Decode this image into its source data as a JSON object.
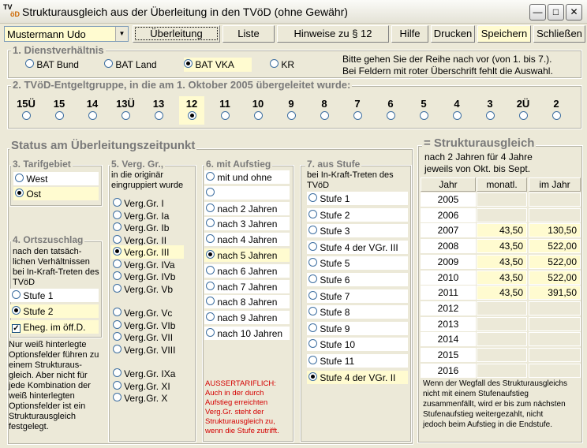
{
  "window": {
    "title": "Strukturausgleich aus der Überleitung in den TVöD (ohne Gewähr)",
    "icon_top": "TV",
    "icon_bottom": "öD"
  },
  "toolbar": {
    "user": "Mustermann Udo",
    "buttons": [
      "Überleitung",
      "Liste",
      "Hinweise zu § 12",
      "Hilfe",
      "Drucken",
      "Speichern",
      "Schließen"
    ]
  },
  "section1": {
    "legend": "1. Dienstverhältnis",
    "options": [
      "BAT Bund",
      "BAT Land",
      "BAT VKA",
      "KR"
    ],
    "selected": "BAT VKA",
    "hint1": "Bitte gehen Sie der Reihe nach vor (von 1. bis 7.).",
    "hint2": "Bei Feldern mit roter Überschrift fehlt die Auswahl."
  },
  "section2": {
    "legend": "2. TVöD-Entgeltgruppe, in die am 1. Oktober 2005 übergeleitet wurde:",
    "groups": [
      "15Ü",
      "15",
      "14",
      "13Ü",
      "13",
      "12",
      "11",
      "10",
      "9",
      "8",
      "7",
      "6",
      "5",
      "4",
      "3",
      "2Ü",
      "2"
    ],
    "selected": "12"
  },
  "status": {
    "title": "Status am Überleitungszeitpunkt"
  },
  "tarif": {
    "legend": "3. Tarifgebiet",
    "options": [
      "West",
      "Ost"
    ],
    "selected": "Ost"
  },
  "ortszuschlag": {
    "legend": "4. Ortszuschlag",
    "desc": [
      "nach den tatsäch-",
      "lichen Verhältnissen",
      "bei In-Kraft-Treten des",
      "TVöD"
    ],
    "options": [
      "Stufe 1",
      "Stufe 2"
    ],
    "selected": "Stufe 2",
    "checkbox": "Eheg. im öff.D.",
    "checked": true
  },
  "note_left": [
    "Nur weiß hinterlegte",
    "Optionsfelder führen zu",
    "einem Strukturaus-",
    "gleich. Aber nicht für",
    "jede Kombination der",
    "weiß hinterlegten",
    "Optionsfelder ist ein",
    "Strukturausgleich",
    "festgelegt."
  ],
  "verg": {
    "legend": "5. Verg. Gr.,",
    "desc": [
      "in die originär",
      "eingruppiert wurde"
    ],
    "groups1": [
      "Verg.Gr. I",
      "Verg.Gr. Ia",
      "Verg.Gr. Ib",
      "Verg.Gr. II",
      "Verg.Gr. III",
      "Verg.Gr. IVa",
      "Verg.Gr. IVb",
      "Verg.Gr. Vb"
    ],
    "groups2": [
      "Verg.Gr. Vc",
      "Verg.Gr. VIb",
      "Verg.Gr. VII",
      "Verg.Gr. VIII"
    ],
    "groups3": [
      "Verg.Gr. IXa",
      "Verg.Gr. XI",
      "Verg.Gr. X"
    ],
    "selected": "Verg.Gr. III"
  },
  "aufstieg": {
    "legend": "6. mit Aufstieg",
    "options": [
      "mit und ohne",
      "",
      "nach 2 Jahren",
      "nach 3 Jahren",
      "nach 4 Jahren",
      "nach 5 Jahren",
      "nach 6 Jahren",
      "nach 7 Jahren",
      "nach 8 Jahren",
      "nach 9 Jahren",
      "nach 10 Jahren"
    ],
    "selected": "nach 5 Jahren",
    "red_note": [
      "AUSSERTARIFLICH:",
      "Auch in der durch",
      "Aufstieg erreichten",
      "Verg.Gr. steht der",
      "Strukturausgleich zu,",
      "wenn die Stufe zutrifft."
    ]
  },
  "stufe": {
    "legend": "7. aus Stufe",
    "desc": [
      "bei In-Kraft-Treten des",
      "TVöD"
    ],
    "options": [
      "Stufe 1",
      "Stufe 2",
      "Stufe 3",
      "Stufe 4 der VGr. III",
      "Stufe 5",
      "Stufe 6",
      "Stufe 7",
      "Stufe 8",
      "Stufe 9",
      "Stufe 10",
      "Stufe 11",
      "Stufe 4 der VGr. II"
    ],
    "selected": "Stufe 4 der VGr. II"
  },
  "struktur": {
    "legend": "= Strukturausgleich",
    "desc": [
      "nach 2 Jahren für 4 Jahre",
      "jeweils von Okt. bis Sept."
    ],
    "headers": [
      "Jahr",
      "monatl.",
      "im Jahr"
    ],
    "rows": [
      {
        "year": "2005",
        "monthly": "",
        "yearly": ""
      },
      {
        "year": "2006",
        "monthly": "",
        "yearly": ""
      },
      {
        "year": "2007",
        "monthly": "43,50",
        "yearly": "130,50"
      },
      {
        "year": "2008",
        "monthly": "43,50",
        "yearly": "522,00"
      },
      {
        "year": "2009",
        "monthly": "43,50",
        "yearly": "522,00"
      },
      {
        "year": "2010",
        "monthly": "43,50",
        "yearly": "522,00"
      },
      {
        "year": "2011",
        "monthly": "43,50",
        "yearly": "391,50"
      },
      {
        "year": "2012",
        "monthly": "",
        "yearly": ""
      },
      {
        "year": "2013",
        "monthly": "",
        "yearly": ""
      },
      {
        "year": "2014",
        "monthly": "",
        "yearly": ""
      },
      {
        "year": "2015",
        "monthly": "",
        "yearly": ""
      },
      {
        "year": "2016",
        "monthly": "",
        "yearly": ""
      }
    ],
    "note": [
      "Wenn der Wegfall des Strukturausgleichs",
      "nicht mit einem Stufenaufstieg",
      "zusammenfällt, wird er bis zum nächsten",
      "Stufenaufstieg weitergezahlt, nicht",
      "jedoch beim Aufstieg in die Endstufe."
    ]
  }
}
